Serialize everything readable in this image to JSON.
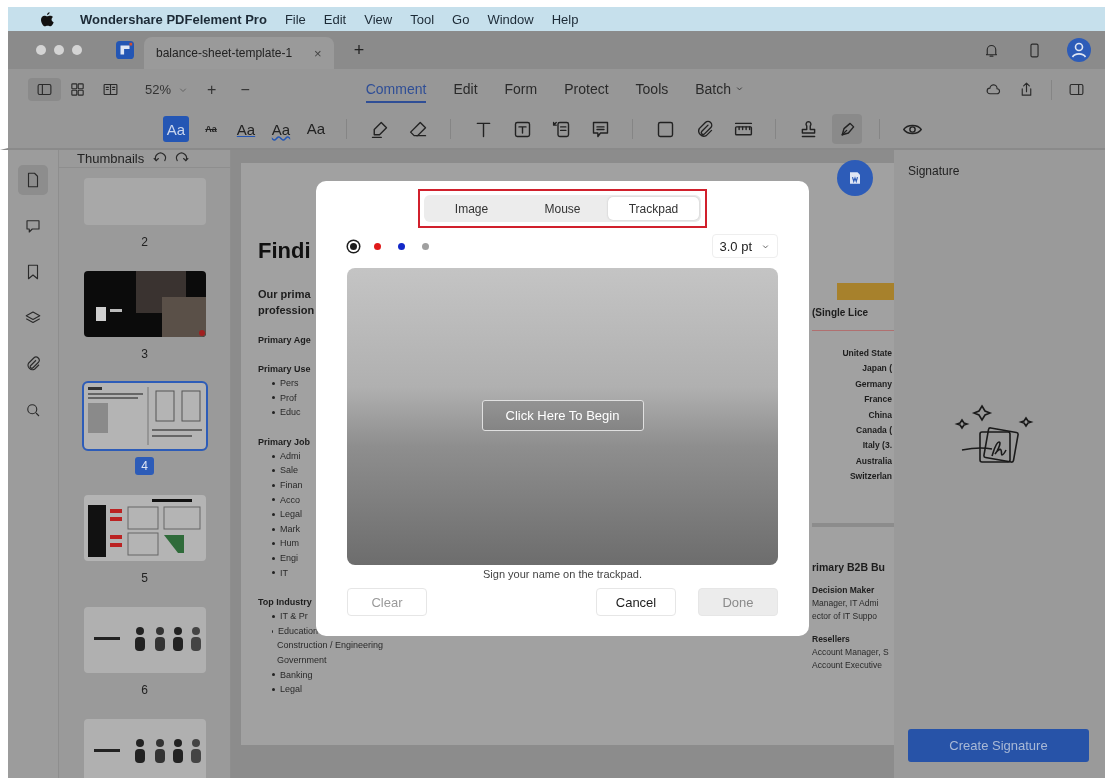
{
  "menu_bar": {
    "app_name": "Wondershare PDFelement Pro",
    "items": [
      "File",
      "Edit",
      "View",
      "Tool",
      "Go",
      "Window",
      "Help"
    ]
  },
  "tab_bar": {
    "tabs": [
      {
        "title": "balance-sheet-template-1",
        "close": "×",
        "selected": true
      }
    ],
    "new_tab": "+"
  },
  "toolbar": {
    "zoom": "52%",
    "zoom_in": "+",
    "zoom_out": "−",
    "modes": [
      {
        "label": "Comment",
        "selected": true,
        "dropdown": false
      },
      {
        "label": "Edit",
        "selected": false,
        "dropdown": false
      },
      {
        "label": "Form",
        "selected": false,
        "dropdown": false
      },
      {
        "label": "Protect",
        "selected": false,
        "dropdown": false
      },
      {
        "label": "Tools",
        "selected": false,
        "dropdown": false
      },
      {
        "label": "Batch",
        "selected": false,
        "dropdown": true
      }
    ]
  },
  "tool_groups": [
    [
      {
        "kind": "highlight-text",
        "label": "Aa",
        "selected": true
      },
      {
        "kind": "strikethrough",
        "label": "Aa",
        "selected": false
      },
      {
        "kind": "underline",
        "label": "Aa",
        "selected": false
      },
      {
        "kind": "squiggly",
        "label": "Aa",
        "selected": false
      },
      {
        "kind": "insert-text",
        "label": "Aa",
        "selected": false
      }
    ],
    [
      {
        "kind": "highlighter",
        "selected": false
      },
      {
        "kind": "eraser",
        "selected": false
      }
    ],
    [
      {
        "kind": "text",
        "selected": false
      },
      {
        "kind": "text-box",
        "selected": false
      },
      {
        "kind": "callout",
        "selected": false
      },
      {
        "kind": "note",
        "selected": false
      }
    ],
    [
      {
        "kind": "rectangle",
        "selected": false
      },
      {
        "kind": "paperclip",
        "selected": false
      },
      {
        "kind": "ruler",
        "selected": false
      }
    ],
    [
      {
        "kind": "stamp",
        "selected": false
      },
      {
        "kind": "pen",
        "selected": true
      }
    ],
    [
      {
        "kind": "eye",
        "selected": false
      }
    ]
  ],
  "rail": [
    {
      "kind": "document",
      "selected": true
    },
    {
      "kind": "comment",
      "selected": false
    },
    {
      "kind": "bookmark",
      "selected": false
    },
    {
      "kind": "layers",
      "selected": false
    },
    {
      "kind": "paperclip",
      "selected": false
    },
    {
      "kind": "search",
      "selected": false
    }
  ],
  "thumbnails": {
    "title": "Thumbnails",
    "pages": [
      {
        "kind": "text",
        "number": "2",
        "selected": false
      },
      {
        "kind": "photo",
        "number": "3",
        "selected": false
      },
      {
        "kind": "columns",
        "number": "4",
        "selected": true
      },
      {
        "kind": "dashboard",
        "number": "5",
        "selected": false
      },
      {
        "kind": "figures",
        "number": "6",
        "selected": false
      },
      {
        "kind": "figures",
        "selected": false
      }
    ]
  },
  "document": {
    "heading": "Findi",
    "intro": [
      "Our prima",
      "profession"
    ],
    "sections": [
      {
        "title": "Primary Age"
      },
      {
        "title": "Primary Use",
        "items": [
          "Pers",
          "Prof",
          "Educ"
        ]
      },
      {
        "title": "Primary Job",
        "items": [
          "Admi",
          "Sale",
          "Finan",
          "Acco",
          "Legal",
          "Mark",
          "Hum",
          "Engi",
          "IT"
        ]
      },
      {
        "title": "Top Industry",
        "items": [
          "IT & Pr",
          "Education",
          "Construction / Engineering",
          "Government",
          "Banking",
          "Legal"
        ]
      }
    ],
    "right": {
      "license": "(Single Lice",
      "countries": [
        "United State",
        "Japan (",
        "Germany",
        "France",
        "China",
        "Canada (",
        "Italy (3.",
        "Australia",
        "Switzerlan"
      ],
      "b2b_title": "rimary B2B Bu",
      "groups": [
        {
          "title": "Decision Maker",
          "lines": [
            "Manager, IT Admi",
            "ector of IT Suppo"
          ]
        },
        {
          "title": "Resellers",
          "lines": [
            "Account Manager, S",
            "Account Executive"
          ]
        }
      ]
    }
  },
  "signature_panel": {
    "title": "Signature",
    "button": "Create Signature"
  },
  "dialog": {
    "tabs": [
      {
        "label": "Image",
        "selected": false
      },
      {
        "label": "Mouse",
        "selected": false
      },
      {
        "label": "Trackpad",
        "selected": true
      }
    ],
    "tabs_outlined": true,
    "pen_colors": [
      {
        "color": "#1c1c1c",
        "selected": true
      },
      {
        "color": "#e01a1a",
        "selected": false
      },
      {
        "color": "#1228c8",
        "selected": false
      },
      {
        "color": "#a0a0a0",
        "selected": false
      }
    ],
    "pen_size": "3.0 pt",
    "start_button": "Click Here To Begin",
    "hint": "Sign your name on the trackpad.",
    "buttons": [
      {
        "label": "Clear",
        "disabled": true
      },
      {
        "label": "Cancel",
        "disabled": false
      },
      {
        "label": "Done",
        "disabled": true
      }
    ]
  }
}
